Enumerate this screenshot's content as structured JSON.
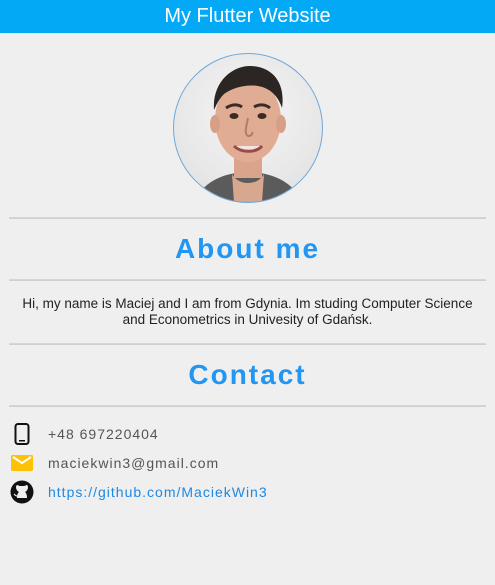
{
  "app_bar": {
    "title": "My Flutter Website"
  },
  "profile": {
    "avatar_icon": "profile-photo",
    "accent_color": "#2196f3"
  },
  "about": {
    "title": "About me",
    "text": "Hi, my name is Maciej and I am from Gdynia. Im studing Computer Science and Econometrics in Univesity of Gdańsk."
  },
  "contact": {
    "title": "Contact",
    "items": [
      {
        "icon": "smartphone-icon",
        "text": "+48 697220404"
      },
      {
        "icon": "email-icon",
        "text": "maciekwin3@gmail.com",
        "icon_color": "#ffc107"
      },
      {
        "icon": "github-icon",
        "text": "https://github.com/MaciekWin3",
        "link_color": "#1e88e5"
      }
    ]
  }
}
